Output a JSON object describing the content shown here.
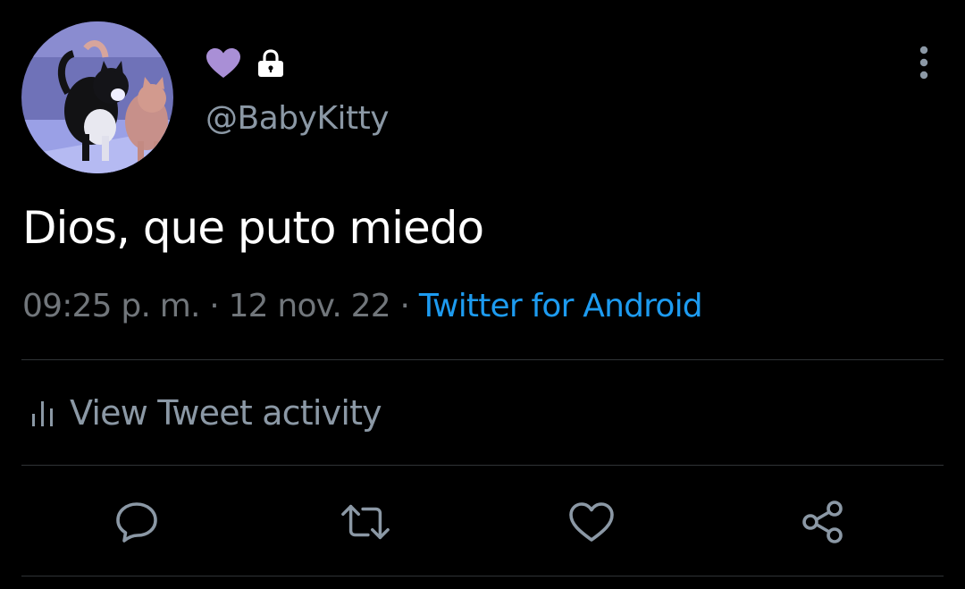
{
  "profile": {
    "handle": "@BabyKitty",
    "heart_color": "#a98fd6",
    "lock_color": "#ffffff"
  },
  "tweet": {
    "text": "Dios, que puto miedo",
    "time": "09:25 p. m.",
    "separator": " · ",
    "date": "12 nov. 22",
    "source": "Twitter for Android"
  },
  "activity": {
    "label": "View Tweet activity"
  },
  "colors": {
    "background": "#000000",
    "primary_text": "#ffffff",
    "secondary_text": "#71767b",
    "link": "#1d9bf0",
    "divider": "#2f3336",
    "icon": "#8b98a5"
  },
  "icons": {
    "heart": "purple-heart-icon",
    "lock": "lock-icon",
    "more": "more-vertical-icon",
    "activity": "bar-chart-icon",
    "reply": "reply-bubble-icon",
    "retweet": "retweet-icon",
    "like": "heart-outline-icon",
    "share": "share-icon"
  }
}
